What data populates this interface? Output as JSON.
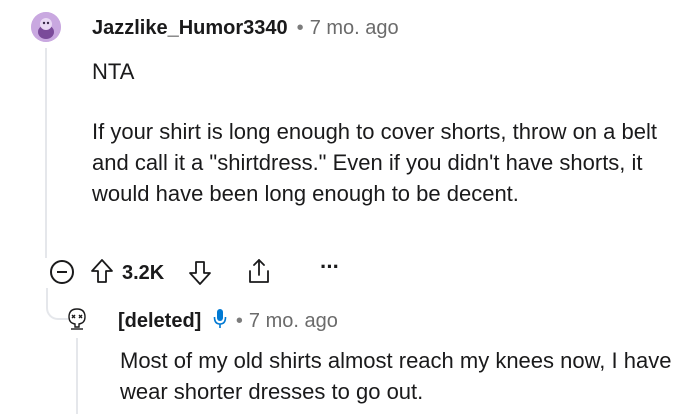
{
  "comment": {
    "username": "Jazzlike_Humor3340",
    "separator": "•",
    "time": "7 mo. ago",
    "title_text": "NTA",
    "body": "If your shirt is long enough to cover shorts, throw on a belt and call it a \"shirtdress.\" Even if you didn't have shorts, it would have been long enough to be decent.",
    "score": "3.2K",
    "more_label": "···"
  },
  "reply": {
    "username": "[deleted]",
    "separator": "•",
    "time": "7 mo. ago",
    "body": "Most of my old shirts almost reach my knees now, I have wear shorter dresses to go out."
  },
  "icons": {
    "collapse": "minus-circle-icon",
    "upvote": "upvote-arrow-icon",
    "downvote": "downvote-arrow-icon",
    "share": "share-icon",
    "more": "more-dots-icon",
    "mic": "microphone-icon",
    "avatar": "snoo-avatar-icon",
    "deleted_avatar": "deleted-user-icon"
  },
  "colors": {
    "avatar_bg": "#c9a8e0",
    "mic": "#0079d3",
    "thread_line": "#e5e7eb",
    "meta_gray": "#6b6b6b"
  }
}
